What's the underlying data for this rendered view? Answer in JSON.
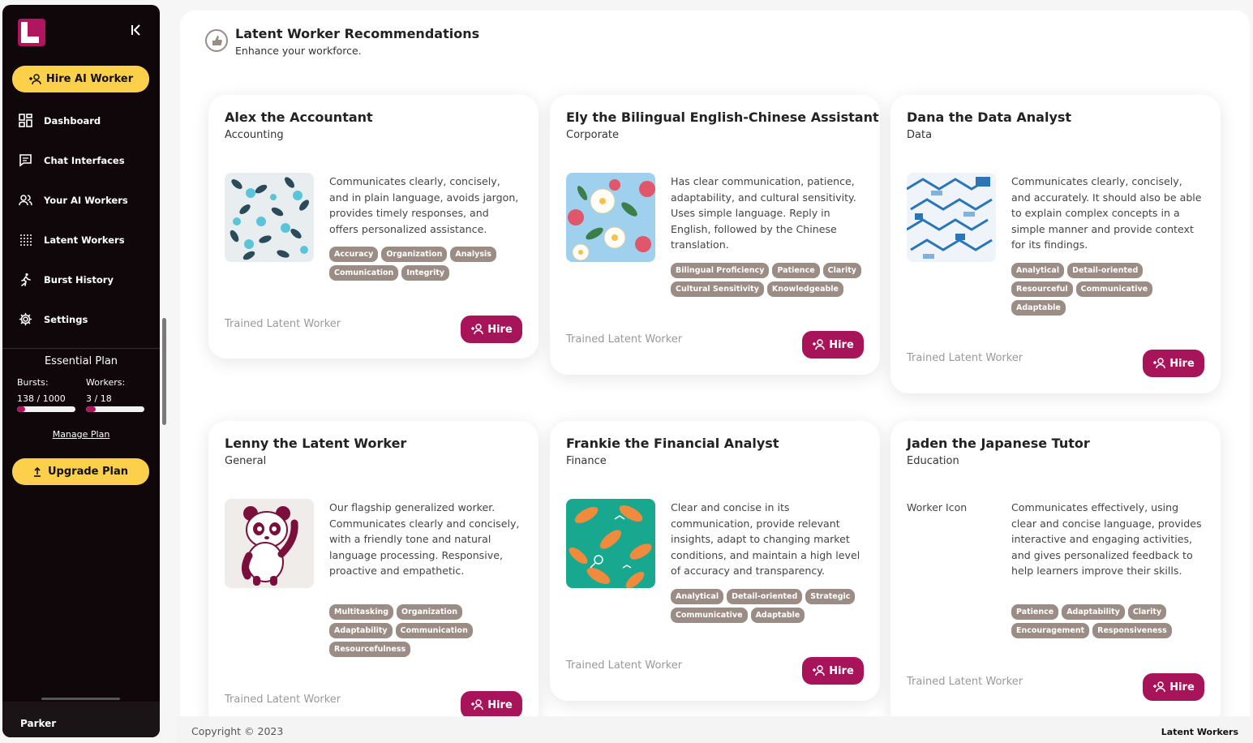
{
  "sidebar": {
    "hire_button": "Hire AI Worker",
    "nav": [
      {
        "label": "Dashboard",
        "icon": "dashboard-icon"
      },
      {
        "label": "Chat Interfaces",
        "icon": "chat-icon"
      },
      {
        "label": "Your AI Workers",
        "icon": "users-icon"
      },
      {
        "label": "Latent Workers",
        "icon": "grid-dots-icon"
      },
      {
        "label": "Burst History",
        "icon": "running-icon"
      },
      {
        "label": "Settings",
        "icon": "gear-icon"
      }
    ],
    "plan": {
      "title": "Essential Plan",
      "bursts_label": "Bursts:",
      "bursts_value": "138 / 1000",
      "bursts_fraction": 0.138,
      "workers_label": "Workers:",
      "workers_value": "3 / 18",
      "workers_fraction": 0.167,
      "manage": "Manage Plan",
      "upgrade": "Upgrade Plan"
    },
    "user": "Parker"
  },
  "header": {
    "title": "Latent Worker Recommendations",
    "subtitle": "Enhance your workforce."
  },
  "cards": [
    {
      "name": "Alex the Accountant",
      "category": "Accounting",
      "description": "Communicates clearly, concisely, and in plain language, avoids jargon, provides timely responses, and offers personalized assistance.",
      "tags": [
        "Accuracy",
        "Organization",
        "Analysis",
        "Comunication",
        "Integrity"
      ],
      "trained": "Trained Latent Worker",
      "hire": "Hire"
    },
    {
      "name": "Ely the Bilingual English-Chinese Assistant",
      "category": "Corporate",
      "description": "Has clear communication, patience, adaptability, and cultural sensitivity. Uses simple language. Reply in English, followed by the Chinese translation.",
      "tags": [
        "Bilingual Proficiency",
        "Patience",
        "Clarity",
        "Cultural Sensitivity",
        "Knowledgeable"
      ],
      "trained": "Trained Latent Worker",
      "hire": "Hire"
    },
    {
      "name": "Dana the Data Analyst",
      "category": "Data",
      "description": "Communicates clearly, concisely, and accurately. It should also be able to explain complex concepts in a simple manner and provide context for its findings.",
      "tags": [
        "Analytical",
        "Detail-oriented",
        "Resourceful",
        "Communicative",
        "Adaptable"
      ],
      "trained": "Trained Latent Worker",
      "hire": "Hire"
    },
    {
      "name": "Lenny the Latent Worker",
      "category": "General",
      "description": "Our flagship generalized worker. Communicates clearly and concisely, with a friendly tone and natural language processing. Responsive, proactive and empathetic.",
      "tags": [
        "Multitasking",
        "Organization",
        "Adaptability",
        "Communication",
        "Resourcefulness"
      ],
      "trained": "Trained Latent Worker",
      "hire": "Hire"
    },
    {
      "name": "Frankie the Financial Analyst",
      "category": "Finance",
      "description": "Clear and concise in its communication, provide relevant insights, adapt to changing market conditions, and maintain a high level of accuracy and transparency.",
      "tags": [
        "Analytical",
        "Detail-oriented",
        "Strategic",
        "Communicative",
        "Adaptable"
      ],
      "trained": "Trained Latent Worker",
      "hire": "Hire"
    },
    {
      "name": "Jaden the Japanese Tutor",
      "category": "Education",
      "image_alt": "Worker Icon",
      "description": "Communicates effectively, using clear and concise language, provides interactive and engaging activities, and gives personalized feedback to help learners improve their skills.",
      "tags": [
        "Patience",
        "Adaptability",
        "Clarity",
        "Encouragement",
        "Responsiveness"
      ],
      "trained": "Trained Latent Worker",
      "hire": "Hire"
    }
  ],
  "footer": {
    "copyright": "Copyright © 2023",
    "brand": "Latent Workers"
  },
  "colors": {
    "accent": "#a8145a",
    "yellow": "#fcd04a",
    "sidebar_bg": "#0f0709",
    "tag": "#9b8c85"
  }
}
